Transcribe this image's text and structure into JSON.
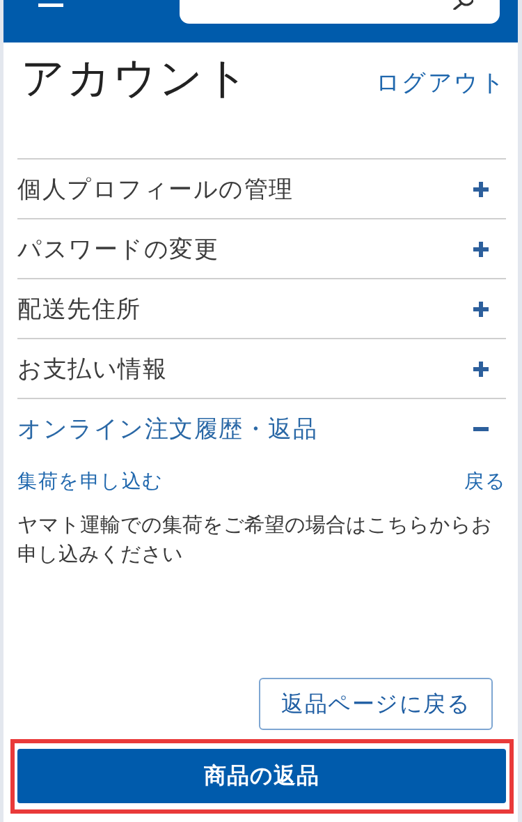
{
  "page": {
    "title": "アカウント",
    "logout": "ログアウト"
  },
  "sections": [
    {
      "label": "個人プロフィールの管理",
      "expanded": false
    },
    {
      "label": "パスワードの変更",
      "expanded": false
    },
    {
      "label": "配送先住所",
      "expanded": false
    },
    {
      "label": "お支払い情報",
      "expanded": false
    },
    {
      "label": "オンライン注文履歴・返品",
      "expanded": true,
      "panel": {
        "link": "集荷を申し込む",
        "back": "戻る",
        "description": "ヤマト運輸での集荷をご希望の場合はこちらからお申し込みください"
      }
    }
  ],
  "buttons": [
    {
      "label": "返品ページに戻る",
      "kind": "outline",
      "highlighted": false
    },
    {
      "label": "商品の返品",
      "kind": "primary",
      "highlighted": true
    }
  ]
}
